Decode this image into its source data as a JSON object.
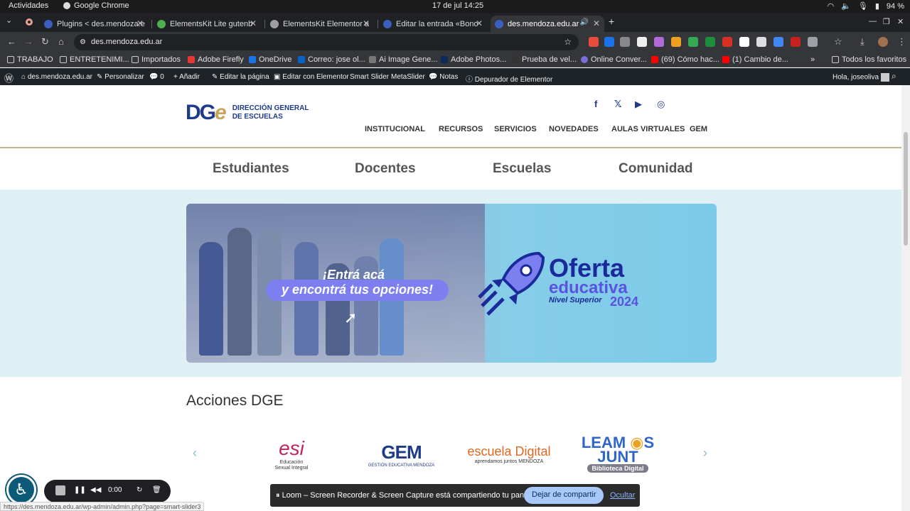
{
  "gnome": {
    "activities": "Actividades",
    "app_name": "Google Chrome",
    "clock": "17 de jul  14:25",
    "battery": "94 %"
  },
  "tabs": [
    {
      "label": "Plugins < des.mendoza.e",
      "color": "#3b5fbf"
    },
    {
      "label": "ElementsKit Lite gutenb",
      "color": "#4caf50"
    },
    {
      "label": "ElementsKit Elementor a",
      "color": "#9e9e9e"
    },
    {
      "label": "Editar la entrada «Bono",
      "color": "#3b5fbf"
    },
    {
      "label": "des.mendoza.edu.ar",
      "color": "#3b5fbf"
    }
  ],
  "toolbar": {
    "url": "des.mendoza.edu.ar"
  },
  "bookmarks": [
    {
      "label": "TRABAJO"
    },
    {
      "label": "ENTRETENIMI..."
    },
    {
      "label": "Importados"
    },
    {
      "label": "Adobe Firefly"
    },
    {
      "label": "OneDrive"
    },
    {
      "label": "Correo: jose ol..."
    },
    {
      "label": "Ai Image Gene..."
    },
    {
      "label": "Adobe Photos..."
    },
    {
      "label": "Prueba de vel..."
    },
    {
      "label": "Online Conver..."
    },
    {
      "label": "(69) Cómo hac..."
    },
    {
      "label": "(1) Cambio de..."
    },
    {
      "label": "Todos los favoritos"
    }
  ],
  "wpbar": {
    "site": "des.mendoza.edu.ar",
    "customize": "Personalizar",
    "comments": "0",
    "add": "Añadir",
    "edit_page": "Editar la página",
    "edit_elementor": "Editar con Elementor",
    "smart_slider": "Smart Slider",
    "metaslider": "MetaSlider",
    "notes": "Notas",
    "debugger": "Depurador de Elementor",
    "greeting": "Hola, joseoliva"
  },
  "site": {
    "logo_text": "DGe",
    "logo_name_line1": "DIRECCIÓN GENERAL",
    "logo_name_line2": "DE ESCUELAS",
    "nav": [
      "INSTITUCIONAL",
      "RECURSOS",
      "SERVICIOS",
      "NOVEDADES",
      "AULAS VIRTUALES",
      "GEM"
    ],
    "subnav": [
      "Estudiantes",
      "Docentes",
      "Escuelas",
      "Comunidad"
    ],
    "banner": {
      "cta_line1": "¡Entrá acá",
      "cta_line2": "y encontrá tus opciones!",
      "oferta_line1": "Oferta",
      "oferta_line2": "educativa",
      "oferta_line3": "Nivel Superior",
      "oferta_year": "2024"
    },
    "acciones_title": "Acciones DGE",
    "logos": {
      "esi_main": "esi",
      "esi_sub1": "Educación",
      "esi_sub2": "Sexual Integral",
      "gem_main": "GEM",
      "gem_sub": "GESTIÓN EDUCATIVA MENDOZA",
      "ed_main": "escuela Digital",
      "ed_sub": "aprendamos juntos MENDOZA",
      "lj_main1": "LEAM",
      "lj_main2": "JUNT",
      "lj_main3": "S",
      "lj_sub": "Biblioteca Digital"
    }
  },
  "loom": {
    "time": "0:00"
  },
  "status_url": "https://des.mendoza.edu.ar/wp-admin/admin.php?page=smart-slider3",
  "share": {
    "message": "Loom – Screen Recorder & Screen Capture está compartiendo tu pantalla.",
    "stop": "Dejar de compartir",
    "hide": "Ocultar"
  }
}
